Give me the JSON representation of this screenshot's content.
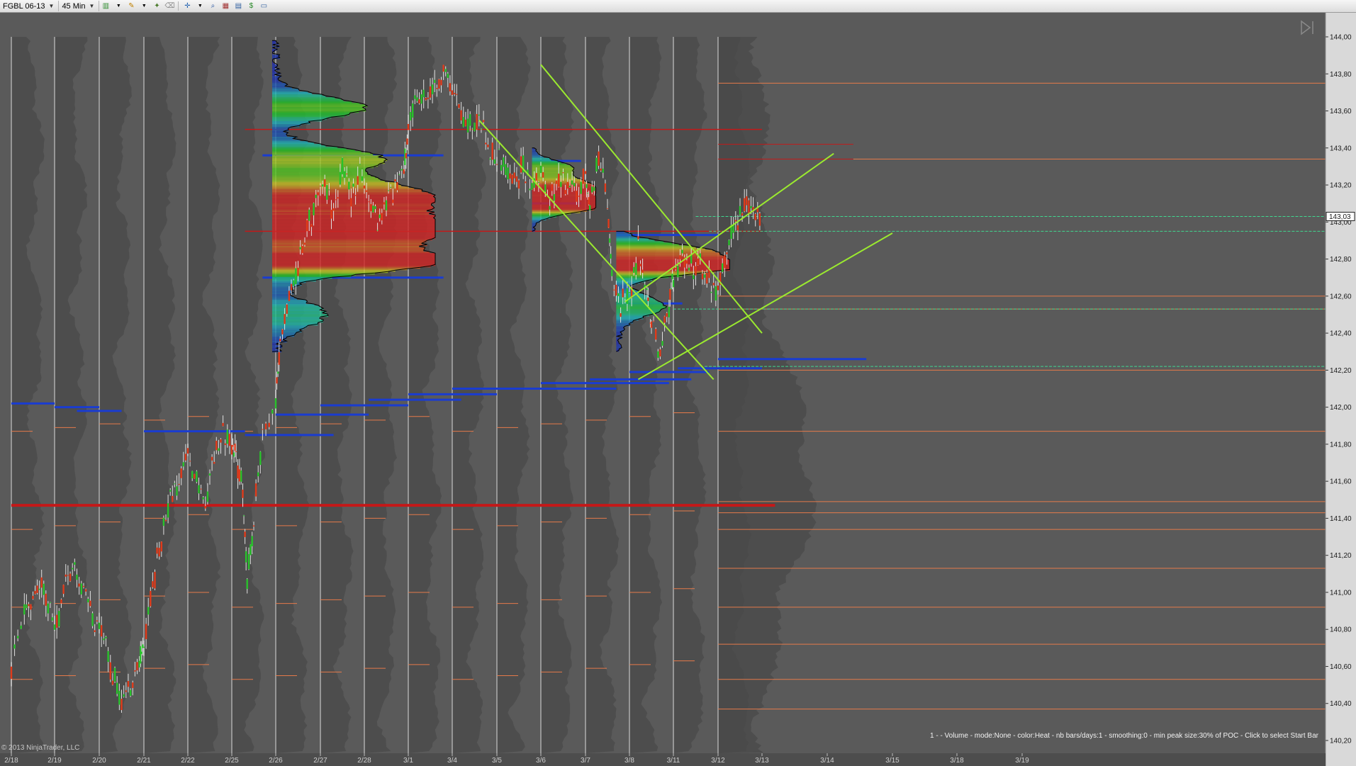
{
  "toolbar": {
    "instrument": "FGBL 06-13",
    "interval": "45 Min",
    "icons": [
      "bar-style-icon",
      "pencil-draw-icon",
      "crosshair-icon",
      "zoom-icon",
      "properties-icon",
      "strategy-icon",
      "indicator-icon",
      "data-box-icon",
      "order-icon",
      "window-icon"
    ]
  },
  "chart_data": {
    "type": "candlestick",
    "instrument": "FGBL 06-13",
    "interval": "45 Min",
    "ylim": [
      140.1,
      144.1
    ],
    "y_ticks": [
      "144,00",
      "143,80",
      "143,60",
      "143,40",
      "143,20",
      "143,00",
      "142,80",
      "142,60",
      "142,40",
      "142,20",
      "142,00",
      "141,80",
      "141,60",
      "141,40",
      "141,20",
      "141,00",
      "140,80",
      "140,60",
      "140,40",
      "140,20"
    ],
    "x_ticks": [
      "2/18",
      "2/19",
      "2/20",
      "2/21",
      "2/22",
      "2/25",
      "2/26",
      "2/27",
      "2/28",
      "3/1",
      "3/4",
      "3/5",
      "3/6",
      "3/7",
      "3/8",
      "3/11",
      "3/12",
      "3/13",
      "3/14",
      "3/15",
      "3/18",
      "3/19"
    ],
    "last_price": "143,03",
    "indicator_text": "1 -   - Volume - mode:None  - color:Heat - nb bars/days:1 - smoothing:0 - min peak size:30% of POC - Click to select Start Bar",
    "copyright": "© 2013 NinjaTrader, LLC",
    "price_path": [
      [
        0.0,
        140.62
      ],
      [
        0.3,
        140.88
      ],
      [
        0.5,
        140.95
      ],
      [
        0.7,
        141.05
      ],
      [
        0.9,
        140.9
      ],
      [
        1.1,
        140.85
      ],
      [
        1.3,
        141.12
      ],
      [
        1.5,
        141.08
      ],
      [
        1.7,
        140.98
      ],
      [
        1.9,
        140.85
      ],
      [
        2.1,
        140.72
      ],
      [
        2.3,
        140.55
      ],
      [
        2.5,
        140.42
      ],
      [
        2.7,
        140.5
      ],
      [
        2.9,
        140.6
      ],
      [
        3.0,
        140.75
      ],
      [
        3.2,
        141.02
      ],
      [
        3.4,
        141.3
      ],
      [
        3.6,
        141.5
      ],
      [
        3.8,
        141.6
      ],
      [
        4.0,
        141.72
      ],
      [
        4.2,
        141.62
      ],
      [
        4.4,
        141.5
      ],
      [
        4.6,
        141.72
      ],
      [
        4.8,
        141.85
      ],
      [
        5.0,
        141.78
      ],
      [
        5.1,
        141.72
      ],
      [
        5.25,
        141.55
      ],
      [
        5.35,
        141.05
      ],
      [
        5.5,
        141.4
      ],
      [
        5.7,
        141.85
      ],
      [
        6.0,
        142.05
      ],
      [
        6.1,
        142.4
      ],
      [
        6.3,
        142.6
      ],
      [
        6.5,
        142.75
      ],
      [
        6.7,
        142.95
      ],
      [
        6.9,
        143.1
      ],
      [
        7.1,
        143.2
      ],
      [
        7.3,
        143.05
      ],
      [
        7.5,
        143.28
      ],
      [
        7.7,
        143.15
      ],
      [
        7.9,
        143.28
      ],
      [
        8.1,
        143.1
      ],
      [
        8.3,
        142.98
      ],
      [
        8.5,
        143.12
      ],
      [
        8.7,
        143.18
      ],
      [
        8.9,
        143.3
      ],
      [
        9.0,
        143.5
      ],
      [
        9.2,
        143.72
      ],
      [
        9.4,
        143.65
      ],
      [
        9.6,
        143.7
      ],
      [
        9.8,
        143.8
      ],
      [
        10.0,
        143.72
      ],
      [
        10.2,
        143.6
      ],
      [
        10.4,
        143.52
      ],
      [
        10.6,
        143.55
      ],
      [
        10.8,
        143.4
      ],
      [
        11.0,
        143.35
      ],
      [
        11.2,
        143.28
      ],
      [
        11.4,
        143.22
      ],
      [
        11.6,
        143.3
      ],
      [
        11.8,
        143.2
      ],
      [
        12.0,
        143.25
      ],
      [
        12.2,
        143.12
      ],
      [
        12.4,
        143.22
      ],
      [
        12.6,
        143.2
      ],
      [
        12.8,
        143.15
      ],
      [
        13.0,
        143.25
      ],
      [
        13.1,
        143.1
      ],
      [
        13.3,
        143.35
      ],
      [
        13.5,
        143.1
      ],
      [
        13.6,
        142.7
      ],
      [
        13.8,
        142.55
      ],
      [
        14.0,
        142.6
      ],
      [
        14.2,
        142.85
      ],
      [
        14.4,
        142.6
      ],
      [
        14.5,
        142.45
      ],
      [
        14.7,
        142.3
      ],
      [
        14.9,
        142.55
      ],
      [
        15.0,
        142.7
      ],
      [
        15.2,
        142.8
      ],
      [
        15.4,
        142.78
      ],
      [
        15.6,
        142.75
      ],
      [
        15.8,
        142.7
      ],
      [
        16.0,
        142.62
      ],
      [
        16.2,
        142.85
      ],
      [
        16.4,
        143.0
      ],
      [
        16.6,
        143.1
      ],
      [
        16.8,
        143.05
      ],
      [
        17.0,
        143.03
      ]
    ],
    "poc_levels": [
      141.47,
      142.95,
      143.5
    ],
    "value_area_lines": [
      [
        0.0,
        1.0,
        142.02
      ],
      [
        1.0,
        2.0,
        142.0
      ],
      [
        1.5,
        2.5,
        141.98
      ],
      [
        3.0,
        4.0,
        141.87
      ],
      [
        4.0,
        5.3,
        141.87
      ],
      [
        5.3,
        7.3,
        141.85
      ],
      [
        6.0,
        8.1,
        141.96
      ],
      [
        7.0,
        9.0,
        142.01
      ],
      [
        8.1,
        10.2,
        142.04
      ],
      [
        9.0,
        11.0,
        142.07
      ],
      [
        10.0,
        12.2,
        142.1
      ],
      [
        11.0,
        13.7,
        142.1
      ],
      [
        12.0,
        14.9,
        142.13
      ],
      [
        13.1,
        15.4,
        142.15
      ],
      [
        14.0,
        15.8,
        142.19
      ],
      [
        15.1,
        17.0,
        142.21
      ],
      [
        16.0,
        18.6,
        142.26
      ],
      [
        5.7,
        9.8,
        143.36
      ],
      [
        5.7,
        9.8,
        142.7
      ],
      [
        11.8,
        12.9,
        143.33
      ],
      [
        11.8,
        12.9,
        143.1
      ],
      [
        13.7,
        16.0,
        142.93
      ],
      [
        13.7,
        15.2,
        142.56
      ]
    ],
    "trendlines": [
      [
        12.0,
        143.85,
        17.0,
        142.4
      ],
      [
        10.6,
        143.55,
        15.9,
        142.15
      ],
      [
        14.2,
        142.15,
        19.0,
        142.94
      ],
      [
        13.9,
        142.57,
        18.1,
        143.37
      ]
    ]
  }
}
